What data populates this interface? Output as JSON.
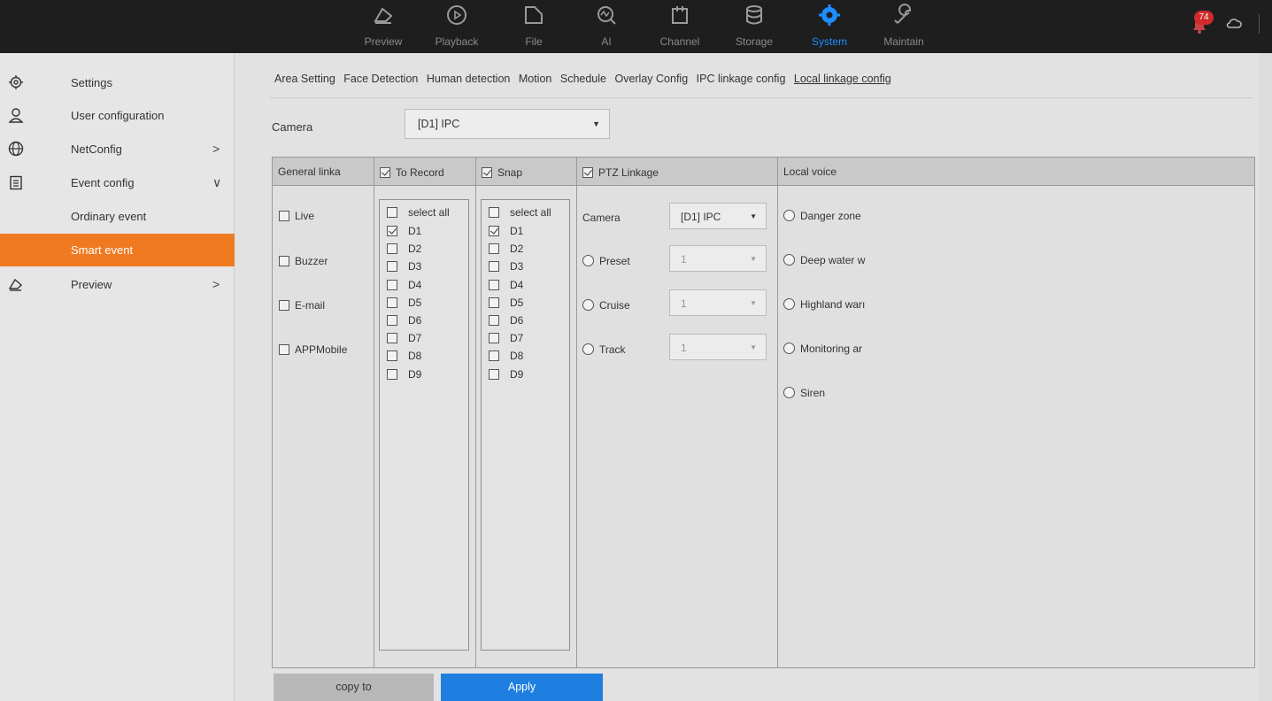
{
  "topnav": [
    {
      "label": "Preview",
      "icon": "preview-camera-icon"
    },
    {
      "label": "Playback",
      "icon": "playback-icon"
    },
    {
      "label": "File",
      "icon": "file-icon"
    },
    {
      "label": "AI",
      "icon": "ai-icon"
    },
    {
      "label": "Channel",
      "icon": "channel-icon"
    },
    {
      "label": "Storage",
      "icon": "storage-icon"
    },
    {
      "label": "System",
      "icon": "system-gear-icon",
      "active": true
    },
    {
      "label": "Maintain",
      "icon": "maintain-wrench-icon"
    }
  ],
  "alarm": {
    "count": "74"
  },
  "sidebar": {
    "items": [
      {
        "label": "Settings",
        "icon": "settings-gear-icon"
      },
      {
        "label": "User configuration",
        "icon": "user-icon"
      },
      {
        "label": "NetConfig",
        "icon": "globe-icon",
        "chevron": ">"
      },
      {
        "label": "Event config",
        "icon": "clipboard-icon",
        "chevron": "∨"
      },
      {
        "label": "Ordinary event"
      },
      {
        "label": "Smart event",
        "selected": true
      },
      {
        "label": "Preview",
        "icon": "preview-camera-icon",
        "chevron": ">"
      }
    ]
  },
  "tabs": [
    "Area Setting",
    "Face Detection",
    "Human detection",
    "Motion",
    "Schedule",
    "Overlay Config",
    "IPC linkage config",
    "Local linkage config"
  ],
  "active_tab": "Local linkage config",
  "camera": {
    "label": "Camera",
    "value": "[D1] IPC"
  },
  "table": {
    "general": {
      "header": "General linka",
      "items": [
        {
          "label": "Live",
          "checked": false
        },
        {
          "label": "Buzzer",
          "checked": false
        },
        {
          "label": "E-mail",
          "checked": false
        },
        {
          "label": "APPMobile",
          "checked": false
        }
      ]
    },
    "record": {
      "header": "To Record",
      "header_checked": true,
      "select_all": "select all",
      "channels": [
        {
          "label": "D1",
          "checked": true
        },
        {
          "label": "D2",
          "checked": false
        },
        {
          "label": "D3",
          "checked": false
        },
        {
          "label": "D4",
          "checked": false
        },
        {
          "label": "D5",
          "checked": false
        },
        {
          "label": "D6",
          "checked": false
        },
        {
          "label": "D7",
          "checked": false
        },
        {
          "label": "D8",
          "checked": false
        },
        {
          "label": "D9",
          "checked": false
        }
      ]
    },
    "snap": {
      "header": "Snap",
      "header_checked": true,
      "select_all": "select all",
      "channels": [
        {
          "label": "D1",
          "checked": true
        },
        {
          "label": "D2",
          "checked": false
        },
        {
          "label": "D3",
          "checked": false
        },
        {
          "label": "D4",
          "checked": false
        },
        {
          "label": "D5",
          "checked": false
        },
        {
          "label": "D6",
          "checked": false
        },
        {
          "label": "D7",
          "checked": false
        },
        {
          "label": "D8",
          "checked": false
        },
        {
          "label": "D9",
          "checked": false
        }
      ]
    },
    "ptz": {
      "header": "PTZ Linkage",
      "header_checked": true,
      "camera_label": "Camera",
      "camera_value": "[D1] IPC",
      "preset_label": "Preset",
      "preset_value": "1",
      "cruise_label": "Cruise",
      "cruise_value": "1",
      "track_label": "Track",
      "track_value": "1"
    },
    "voice": {
      "header": "Local voice",
      "items": [
        "Danger zone",
        "Deep water w",
        "Highland warı",
        "Monitoring ar",
        "Siren"
      ]
    }
  },
  "buttons": {
    "copy": "copy to",
    "apply": "Apply"
  },
  "colors": {
    "accent_orange": "#ef7a22",
    "accent_blue": "#1f7fe0",
    "active_nav": "#1f8cff",
    "badge_red": "#d02a2a"
  }
}
